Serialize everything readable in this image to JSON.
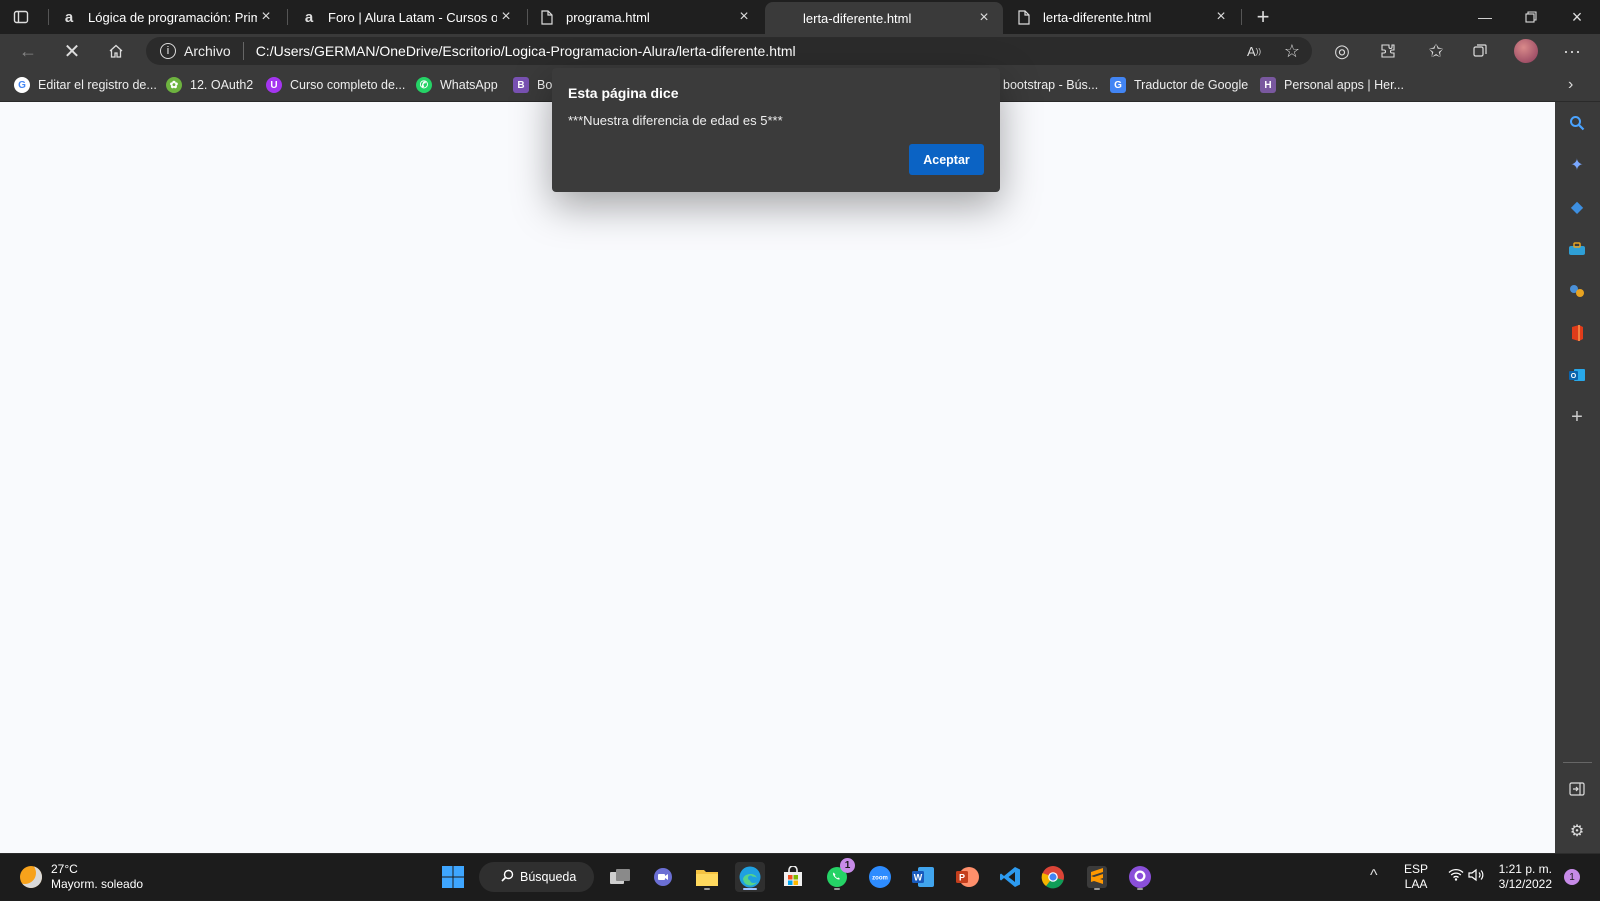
{
  "tabs": [
    {
      "title": "Lógica de programación: Primero",
      "icon": "alura-icon",
      "active": false
    },
    {
      "title": "Foro | Alura Latam - Cursos online",
      "icon": "alura-icon",
      "active": false
    },
    {
      "title": "programa.html",
      "icon": "file-icon",
      "active": false
    },
    {
      "title": "lerta-diferente.html",
      "icon": "none",
      "active": true
    },
    {
      "title": "lerta-diferente.html",
      "icon": "file-icon",
      "active": false
    }
  ],
  "address": {
    "scheme_label": "Archivo",
    "url": "C:/Users/GERMAN/OneDrive/Escritorio/Logica-Programacion-Alura/lerta-diferente.html"
  },
  "bookmarks": [
    {
      "label": "Editar el registro de...",
      "icon": "google-icon",
      "color": "#ffffff"
    },
    {
      "label": "12. OAuth2",
      "icon": "spring-leaf-icon",
      "color": "#6db33f"
    },
    {
      "label": "Curso completo de...",
      "icon": "udemy-icon",
      "color": "#a435f0"
    },
    {
      "label": "WhatsApp",
      "icon": "whatsapp-icon",
      "color": "#25d366"
    },
    {
      "label": "Bo",
      "icon": "bootstrap-icon",
      "color": "#7952b3"
    },
    {
      "label": "bootstrap - Bús...",
      "icon": "bing-icon",
      "color": "#3a3a3a"
    },
    {
      "label": "Traductor de Google",
      "icon": "google-translate-icon",
      "color": "#4285f4"
    },
    {
      "label": "Personal apps | Her...",
      "icon": "heroku-icon",
      "color": "#79589f"
    }
  ],
  "dialog": {
    "title": "Esta página dice",
    "message": "***Nuestra diferencia de edad es 5***",
    "ok_label": "Aceptar"
  },
  "taskbar": {
    "weather_temp": "27°C",
    "weather_desc": "Mayorm. soleado",
    "search_label": "Búsqueda",
    "whatsapp_badge": "1",
    "lang_top": "ESP",
    "lang_bottom": "LAA",
    "time": "1:21 p. m.",
    "date": "3/12/2022",
    "notif_count": "1"
  },
  "colors": {
    "accent_button": "#0b63c4",
    "page_bg": "#f9fafd",
    "chrome_bg": "#3a3a3a"
  }
}
